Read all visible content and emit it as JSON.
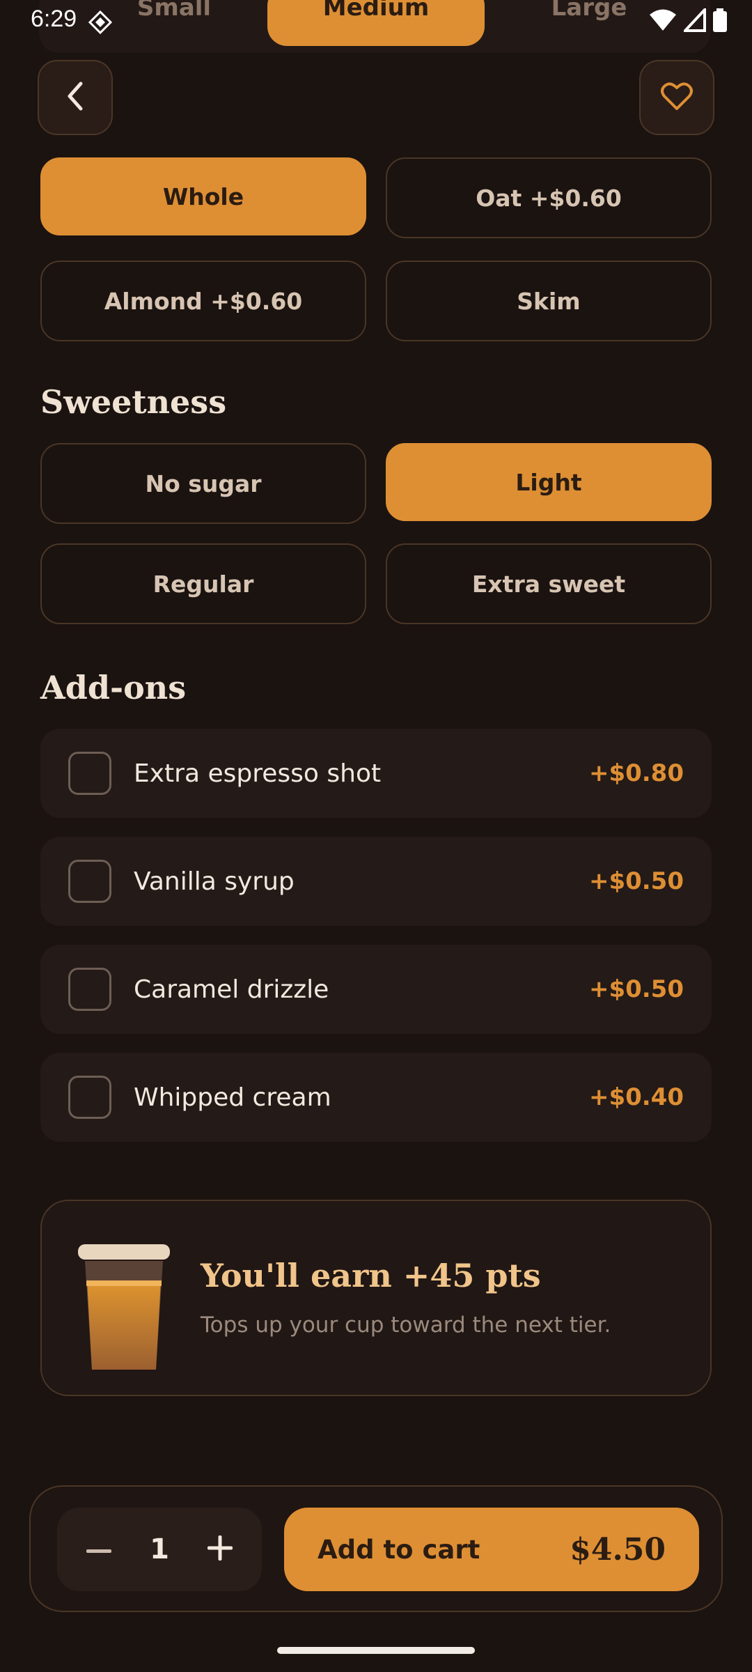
{
  "status_bar": {
    "time": "6:29"
  },
  "size": {
    "options": [
      "Small",
      "Medium",
      "Large"
    ],
    "selected": "Medium"
  },
  "milk": {
    "options": [
      {
        "label": "Whole",
        "selected": true
      },
      {
        "label": "Oat  +$0.60",
        "selected": false
      },
      {
        "label": "Almond  +$0.60",
        "selected": false
      },
      {
        "label": "Skim",
        "selected": false
      }
    ]
  },
  "sweetness": {
    "title": "Sweetness",
    "options": [
      {
        "label": "No sugar",
        "selected": false
      },
      {
        "label": "Light",
        "selected": true
      },
      {
        "label": "Regular",
        "selected": false
      },
      {
        "label": "Extra sweet",
        "selected": false
      }
    ]
  },
  "addons": {
    "title": "Add-ons",
    "items": [
      {
        "name": "Extra espresso shot",
        "price": "+$0.80",
        "checked": false
      },
      {
        "name": "Vanilla syrup",
        "price": "+$0.50",
        "checked": false
      },
      {
        "name": "Caramel drizzle",
        "price": "+$0.50",
        "checked": false
      },
      {
        "name": "Whipped cream",
        "price": "+$0.40",
        "checked": false
      }
    ]
  },
  "points": {
    "title": "You'll earn +45 pts",
    "subtitle": "Tops up your cup toward the next tier."
  },
  "cart": {
    "quantity": "1",
    "add_label": "Add to cart",
    "total": "$4.50"
  },
  "colors": {
    "background": "#1b1310",
    "accent": "#de8f34",
    "card": "#241a17",
    "border": "#4a3626"
  },
  "icons": [
    "back-chevron-icon",
    "heart-icon",
    "minus-icon",
    "plus-icon",
    "wifi-icon",
    "signal-icon",
    "battery-icon",
    "cup-icon"
  ]
}
